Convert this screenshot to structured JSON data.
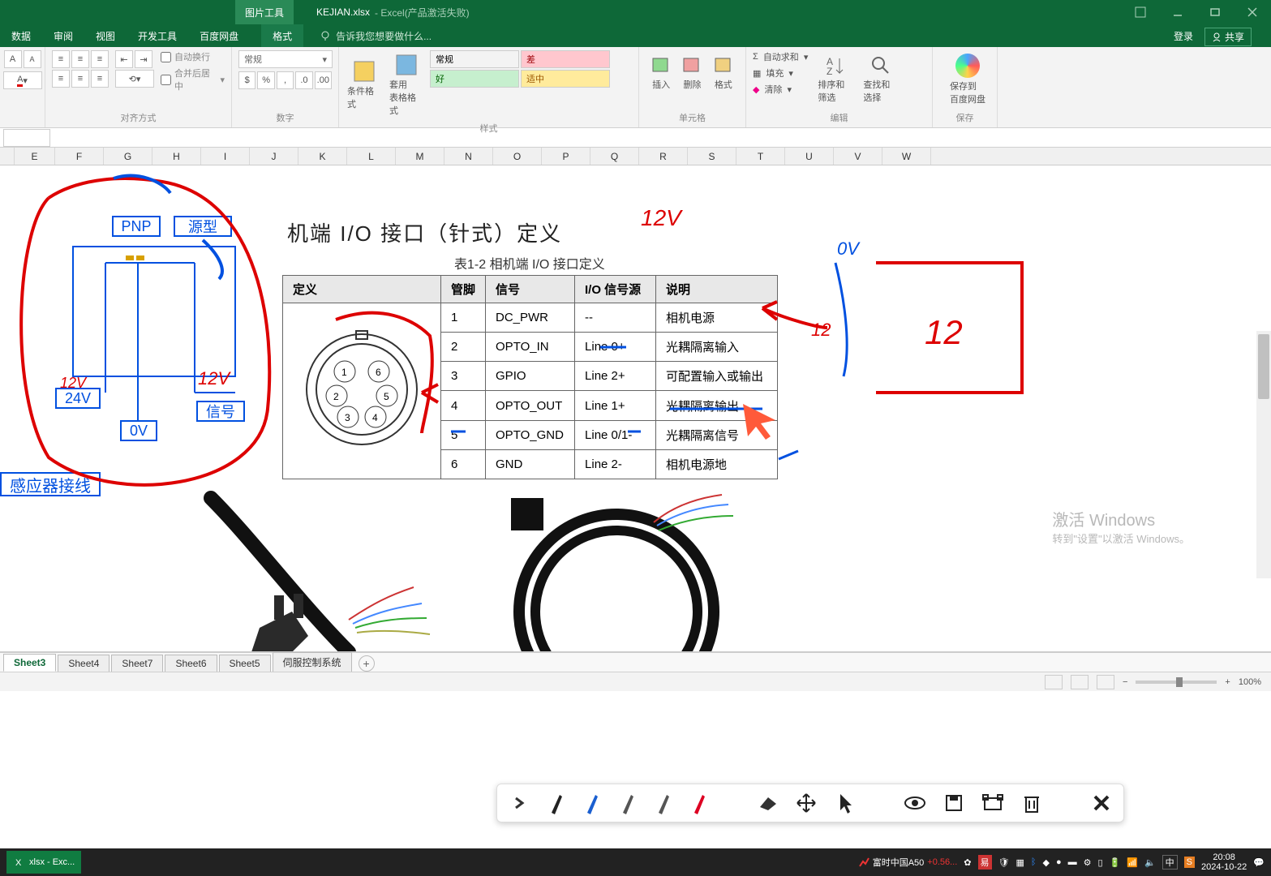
{
  "title": {
    "tool_tab": "图片工具",
    "format_tab": "格式",
    "filename": "KEJIAN.xlsx",
    "status": "- Excel(产品激活失败)"
  },
  "window_btns": {
    "login": "登录",
    "share": "共享"
  },
  "tabs": {
    "data": "数据",
    "review": "审阅",
    "view": "视图",
    "devtools": "开发工具",
    "baidu": "百度网盘",
    "format": "格式",
    "tellme": "告诉我您想要做什么..."
  },
  "ribbon": {
    "font_a1": "A",
    "font_a2": "A",
    "wrap": "自动换行",
    "merge": "合并后居中",
    "group_align": "对齐方式",
    "number_fmt": "常规",
    "group_number": "数字",
    "cond_fmt": "条件格式",
    "table_fmt": "套用\n表格格式",
    "group_styles": "样式",
    "style1": "常规",
    "style2": "差",
    "style3": "好",
    "style4": "适中",
    "insert": "插入",
    "delete": "删除",
    "format": "格式",
    "group_cells": "单元格",
    "autosum": "自动求和",
    "fill": "填充",
    "clear": "清除",
    "sort": "排序和筛选",
    "find": "查找和选择",
    "group_edit": "编辑",
    "baidu_save": "保存到\n百度网盘",
    "group_baidu": "保存"
  },
  "columns": [
    "E",
    "F",
    "G",
    "H",
    "I",
    "J",
    "K",
    "L",
    "M",
    "N",
    "O",
    "P",
    "Q",
    "R",
    "S",
    "T",
    "U",
    "V",
    "W"
  ],
  "diagram": {
    "pnp": "PNP",
    "source_type": "源型",
    "v24": "24V",
    "v0": "0V",
    "signal": "信号",
    "sensor_wiring": "感应器接线",
    "annotation_12v_left": "12V",
    "annotation_12v_red": "12V",
    "annotation_12v_top": "12V",
    "annotation_0v_blue": "0V",
    "annotation_12_blue": "12",
    "annotation_12_red2": "12"
  },
  "io_interface": {
    "title": "机端 I/O 接口（针式）定义",
    "caption": "表1-2  相机端 I/O 接口定义",
    "col_def": "定义",
    "headers": {
      "pin": "管脚",
      "signal": "信号",
      "io_source": "I/O 信号源",
      "desc": "说明"
    },
    "rows": [
      {
        "pin": "1",
        "signal": "DC_PWR",
        "io": "--",
        "desc": "相机电源"
      },
      {
        "pin": "2",
        "signal": "OPTO_IN",
        "io": "Line 0+",
        "desc": "光耦隔离输入"
      },
      {
        "pin": "3",
        "signal": "GPIO",
        "io": "Line 2+",
        "desc": "可配置输入或输出"
      },
      {
        "pin": "4",
        "signal": "OPTO_OUT",
        "io": "Line 1+",
        "desc": "光耦隔离输出"
      },
      {
        "pin": "5",
        "signal": "OPTO_GND",
        "io": "Line 0/1-",
        "desc": "光耦隔离信号"
      },
      {
        "pin": "6",
        "signal": "GND",
        "io": "Line 2-",
        "desc": "相机电源地"
      }
    ],
    "connector_pins": [
      "1",
      "2",
      "3",
      "4",
      "5",
      "6"
    ]
  },
  "sheets": {
    "s3": "Sheet3",
    "s4": "Sheet4",
    "s7": "Sheet7",
    "s6": "Sheet6",
    "s5": "Sheet5",
    "servo": "伺服控制系统"
  },
  "statusbar": {
    "zoom": "100%"
  },
  "watermark": {
    "title": "激活 Windows",
    "sub": "转到\"设置\"以激活 Windows。"
  },
  "taskbar": {
    "excel": "xlsx - Exc...",
    "stock_name": "富时中国A50",
    "stock_change": "+0.56...",
    "ime": "中",
    "time": "20:08",
    "date": "2024-10-22"
  }
}
